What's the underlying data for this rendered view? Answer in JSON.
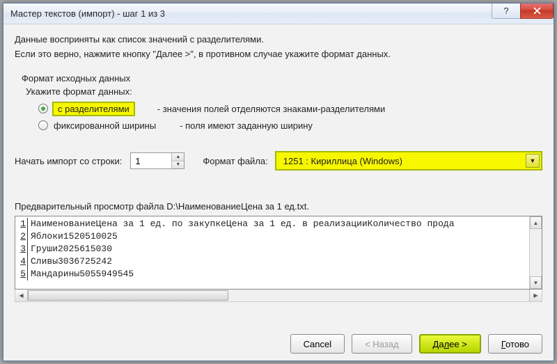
{
  "window": {
    "title": "Мастер текстов (импорт) - шаг 1 из 3"
  },
  "intro1": "Данные восприняты как список значений с разделителями.",
  "intro2": "Если это верно, нажмите кнопку \"Далее >\", в противном случае укажите формат данных.",
  "format_group": {
    "legend": "Формат исходных данных",
    "sub_legend": "Укажите формат данных:",
    "opt1_label": "с разделителями",
    "opt1_desc": "- значения полей отделяются знаками-разделителями",
    "opt2_label": "фиксированной ширины",
    "opt2_desc": "- поля имеют заданную ширину"
  },
  "import_row": {
    "start_label": "Начать импорт со строки:",
    "start_value": "1",
    "file_format_label": "Формат файла:",
    "encoding_value": "1251 : Кириллица (Windows)"
  },
  "preview": {
    "label": "Предварительный просмотр файла D:\\НаименованиеЦена за 1 ед.txt.",
    "lines": [
      "НаименованиеЦена за 1 ед. по закупкеЦена за 1 ед. в реализацииКоличество прода",
      "Яблоки1520510025",
      "Груши2025615030",
      "Сливы3036725242",
      "Мандарины5055949545"
    ]
  },
  "footer": {
    "cancel": "Cancel",
    "back": "< Назад",
    "next": "Далее >",
    "finish": "Готово"
  }
}
